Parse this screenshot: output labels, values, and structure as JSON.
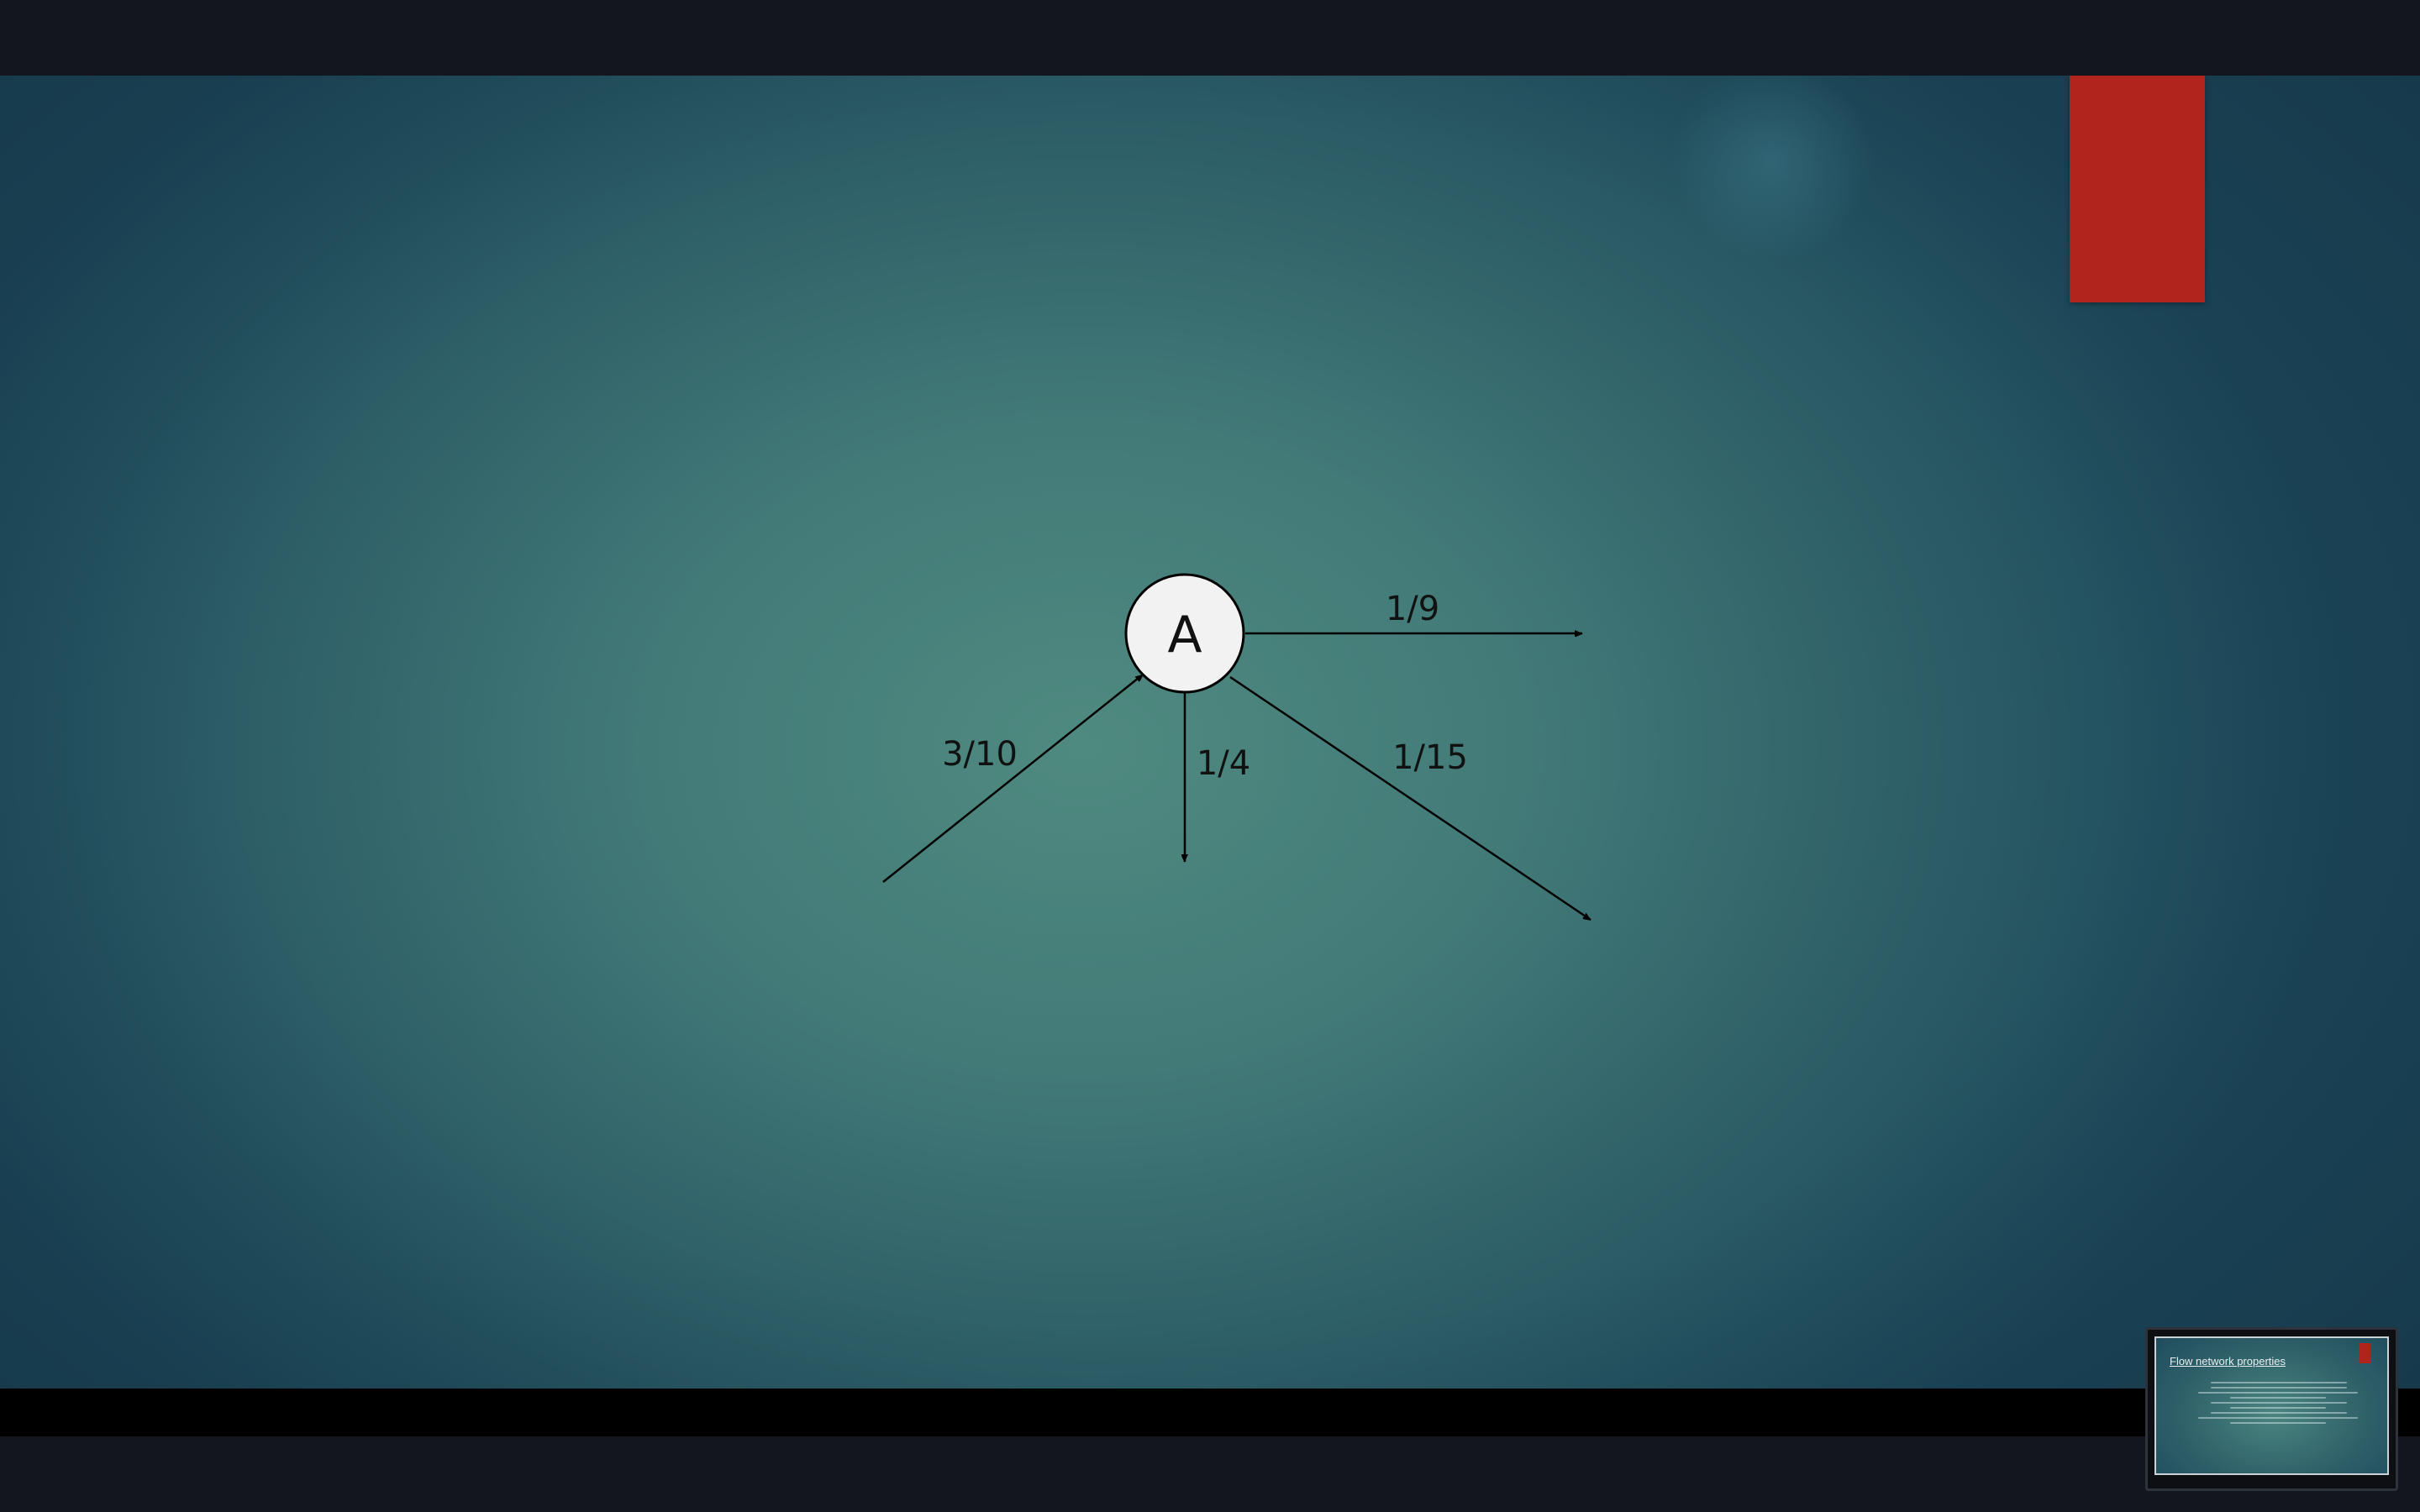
{
  "slide": {
    "node_label": "A",
    "edges": [
      {
        "label": "3/10"
      },
      {
        "label": "1/9"
      },
      {
        "label": "1/4"
      },
      {
        "label": "1/15"
      }
    ]
  },
  "thumbnail": {
    "title": "Flow network properties"
  },
  "colors": {
    "accent_red": "#b1241e",
    "slide_teal": "#4f8a80",
    "node_fill": "#f2f2f2"
  }
}
